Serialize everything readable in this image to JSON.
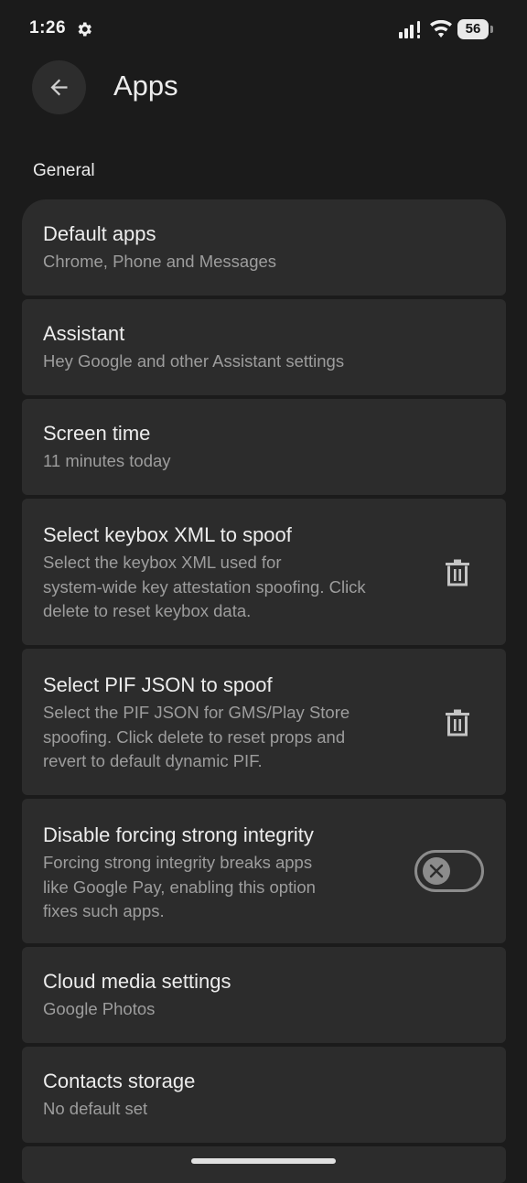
{
  "status_bar": {
    "time": "1:26",
    "battery": "56",
    "icons": [
      "settings-gear-icon",
      "signal-icon",
      "wifi-icon",
      "battery-icon"
    ]
  },
  "header": {
    "back_icon": "arrow-left-icon",
    "title": "Apps"
  },
  "section": {
    "label": "General"
  },
  "items": [
    {
      "title": "Default apps",
      "subtitle": "Chrome, Phone and Messages"
    },
    {
      "title": "Assistant",
      "subtitle": "Hey Google and other Assistant settings"
    },
    {
      "title": "Screen time",
      "subtitle": "11 minutes today"
    },
    {
      "title": "Select keybox XML to spoof",
      "subtitle_lines": [
        "Select the keybox XML used for",
        "system-wide key attestation spoofing. Click",
        "delete to reset keybox data."
      ],
      "action_icon": "trash-icon"
    },
    {
      "title": "Select PIF JSON to spoof",
      "subtitle_lines": [
        "Select the PIF JSON for GMS/Play Store",
        "spoofing. Click delete to reset props and",
        "revert to default dynamic PIF."
      ],
      "action_icon": "trash-icon"
    },
    {
      "title": "Disable forcing strong integrity",
      "subtitle_lines": [
        "Forcing strong integrity breaks apps",
        "like Google Pay, enabling this option",
        "fixes such apps."
      ],
      "toggle": {
        "checked": false
      }
    },
    {
      "title": "Cloud media settings",
      "subtitle": "Google Photos"
    },
    {
      "title": "Contacts storage",
      "subtitle": "No default set"
    }
  ],
  "colors": {
    "background": "#1b1b1b",
    "card": "#2c2c2c",
    "title_text": "#ececec",
    "subtitle_text": "#9d9d9d"
  }
}
